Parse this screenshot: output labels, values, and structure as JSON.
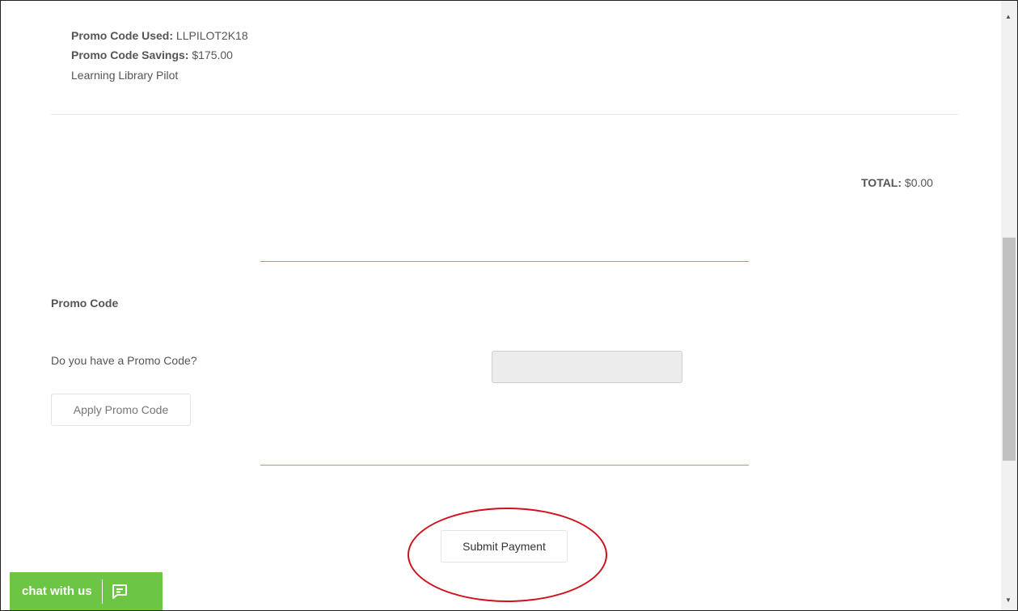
{
  "order": {
    "promo_used_label": "Promo Code Used:",
    "promo_used_value": "LLPILOT2K18",
    "promo_savings_label": "Promo Code Savings:",
    "promo_savings_value": "$175.00",
    "promo_description": "Learning Library Pilot",
    "total_label": "TOTAL:",
    "total_value": "$0.00"
  },
  "promo": {
    "section_title": "Promo Code",
    "question": "Do you have a Promo Code?",
    "input_value": "",
    "apply_button": "Apply Promo Code"
  },
  "submit_button": "Submit Payment",
  "chat": {
    "label": "chat with us",
    "icon": "chat-bubble-icon"
  },
  "scrollbar": {
    "up_icon": "scroll-up-arrow",
    "down_icon": "scroll-down-arrow"
  },
  "colors": {
    "accent_green": "#6cc644",
    "annotation_red": "#d0101a"
  }
}
